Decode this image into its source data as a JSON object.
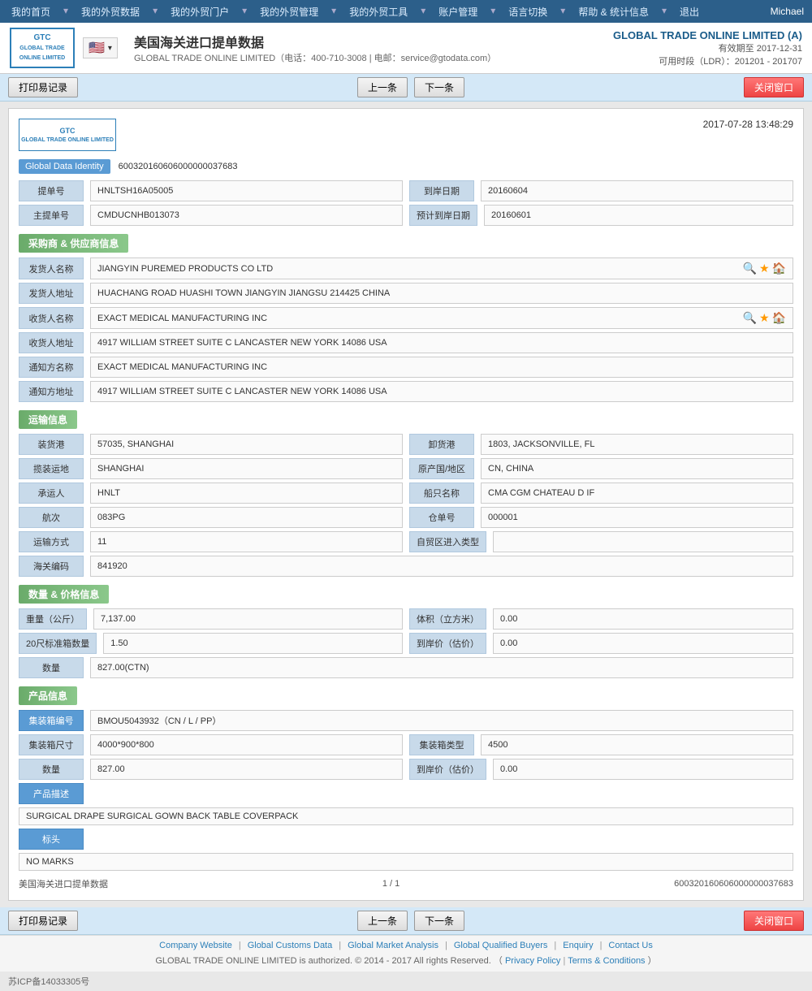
{
  "nav": {
    "items": [
      {
        "label": "我的首页",
        "id": "home"
      },
      {
        "label": "我的外贸数据",
        "id": "trade-data"
      },
      {
        "label": "我的外贸门户",
        "id": "portal"
      },
      {
        "label": "我的外贸管理",
        "id": "management"
      },
      {
        "label": "我的外贸工具",
        "id": "tools"
      },
      {
        "label": "账户管理",
        "id": "account"
      },
      {
        "label": "语言切换",
        "id": "language"
      },
      {
        "label": "帮助 & 统计信息",
        "id": "help"
      },
      {
        "label": "退出",
        "id": "logout"
      }
    ],
    "user": "Michael"
  },
  "header": {
    "page_title": "美国海关进口提单数据",
    "subtitle": "GLOBAL TRADE ONLINE LIMITED（电话：400-710-3008 | 电邮：service@gtodata.com）",
    "company_name": "GLOBAL TRADE ONLINE LIMITED (A)",
    "expiry_label": "有效期至",
    "expiry_date": "2017-12-31",
    "time_label": "可用时段（LDR）：201201 - 201707"
  },
  "toolbar": {
    "print_btn": "打印易记录",
    "prev_btn": "上一条",
    "next_btn": "下一条",
    "close_btn": "关闭窗口"
  },
  "card": {
    "timestamp": "2017-07-28 13:48:29",
    "gdi_label": "Global Data Identity",
    "gdi_value": "600320160606000000037683",
    "bill_no_label": "提单号",
    "bill_no_value": "HNLTSH16A05005",
    "arrival_date_label": "到岸日期",
    "arrival_date_value": "20160604",
    "master_bill_label": "主提单号",
    "master_bill_value": "CMDUCNHB013073",
    "estimated_arrival_label": "预计到岸日期",
    "estimated_arrival_value": "20160601"
  },
  "supplier_section": {
    "title": "采购商 & 供应商信息",
    "shipper_name_label": "发货人名称",
    "shipper_name_value": "JIANGYIN PUREMED PRODUCTS CO LTD",
    "shipper_addr_label": "发货人地址",
    "shipper_addr_value": "HUACHANG ROAD HUASHI TOWN JIANGYIN JIANGSU 214425 CHINA",
    "consignee_name_label": "收货人名称",
    "consignee_name_value": "EXACT MEDICAL MANUFACTURING INC",
    "consignee_addr_label": "收货人地址",
    "consignee_addr_value": "4917 WILLIAM STREET SUITE C LANCASTER NEW YORK 14086 USA",
    "notify_name_label": "通知方名称",
    "notify_name_value": "EXACT MEDICAL MANUFACTURING INC",
    "notify_addr_label": "通知方地址",
    "notify_addr_value": "4917 WILLIAM STREET SUITE C LANCASTER NEW YORK 14086 USA"
  },
  "transport_section": {
    "title": "运输信息",
    "loading_port_label": "装货港",
    "loading_port_value": "57035, SHANGHAI",
    "unloading_port_label": "卸货港",
    "unloading_port_value": "1803, JACKSONVILLE, FL",
    "loading_place_label": "揽装运地",
    "loading_place_value": "SHANGHAI",
    "origin_label": "原产国/地区",
    "origin_value": "CN, CHINA",
    "carrier_label": "承运人",
    "carrier_value": "HNLT",
    "vessel_label": "船只名称",
    "vessel_value": "CMA CGM CHATEAU D IF",
    "voyage_label": "航次",
    "voyage_value": "083PG",
    "bill_of_lading_label": "仓单号",
    "bill_of_lading_value": "000001",
    "transport_mode_label": "运输方式",
    "transport_mode_value": "11",
    "ftz_entry_label": "自贸区进入类型",
    "ftz_entry_value": "",
    "customs_code_label": "海关编码",
    "customs_code_value": "841920"
  },
  "quantity_section": {
    "title": "数量 & 价格信息",
    "weight_label": "重量（公斤）",
    "weight_value": "7,137.00",
    "volume_label": "体积（立方米）",
    "volume_value": "0.00",
    "container_20_label": "20尺标准箱数量",
    "container_20_value": "1.50",
    "arrived_price_label": "到岸价（估价）",
    "arrived_price_value": "0.00",
    "quantity_label": "数量",
    "quantity_value": "827.00(CTN)"
  },
  "product_section": {
    "title": "产品信息",
    "container_no_label": "集装箱编号",
    "container_no_value": "BMOU5043932（CN / L / PP）",
    "container_size_label": "集装箱尺寸",
    "container_size_value": "4000*900*800",
    "container_type_label": "集装箱类型",
    "container_type_value": "4500",
    "quantity_label": "数量",
    "quantity_value": "827.00",
    "arrived_price_label": "到岸价（估价）",
    "arrived_price_value": "0.00",
    "desc_label": "产品描述",
    "desc_value": "SURGICAL DRAPE SURGICAL GOWN BACK TABLE COVERPACK",
    "marks_label": "标头",
    "marks_value": "NO MARKS"
  },
  "page_footer": {
    "title": "美国海关进口提单数据",
    "page_info": "1 / 1",
    "record_id": "600320160606000000037683"
  },
  "footer": {
    "links": [
      {
        "label": "Company Website"
      },
      {
        "label": "Global Customs Data"
      },
      {
        "label": "Global Market Analysis"
      },
      {
        "label": "Global Qualified Buyers"
      },
      {
        "label": "Enquiry"
      },
      {
        "label": "Contact Us"
      }
    ],
    "copyright": "GLOBAL TRADE ONLINE LIMITED is authorized. © 2014 - 2017 All rights Reserved.  （",
    "privacy": "Privacy Policy",
    "terms": "Terms & Conditions",
    "copyright_end": "）",
    "icp": "苏ICP备14033305号"
  }
}
